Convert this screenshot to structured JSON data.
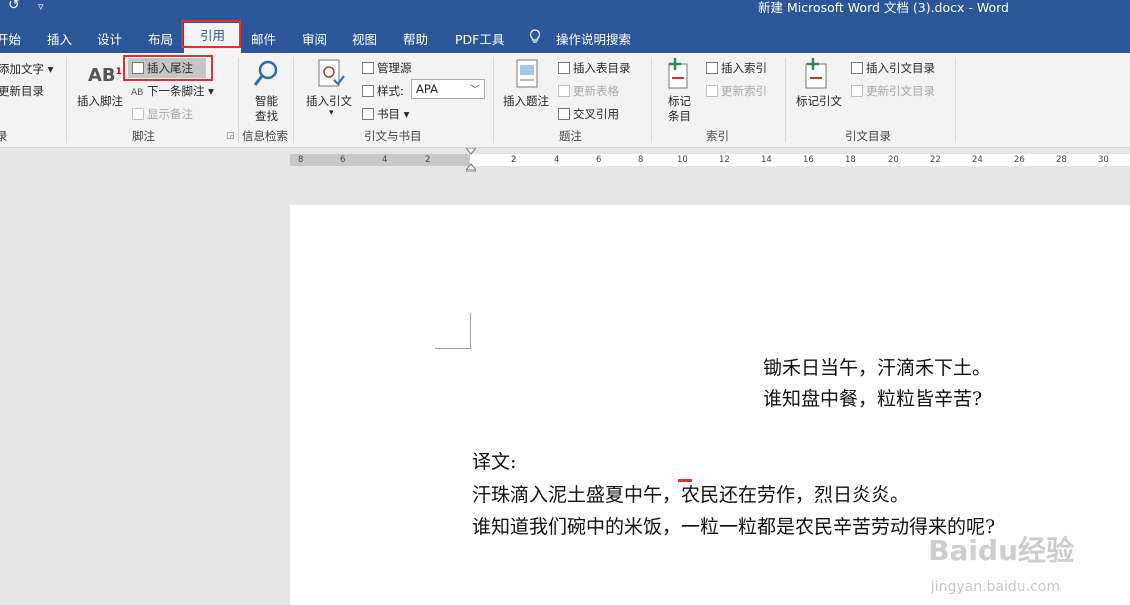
{
  "title_bar": {
    "doc_title": "新建 Microsoft Word 文档 (3).docx  -  Word",
    "undo_icon": "undo-icon",
    "customize_icon": "customize-quick-access-icon"
  },
  "tabs": [
    "开始",
    "插入",
    "设计",
    "布局",
    "引用",
    "邮件",
    "审阅",
    "视图",
    "帮助",
    "PDF工具",
    "操作说明搜索"
  ],
  "active_tab": "引用",
  "ribbon": {
    "toc_group": {
      "add_text": "添加文字",
      "update_toc": "更新目录",
      "label": "录"
    },
    "footnotes_group": {
      "insert_footnote": "插入脚注",
      "insert_endnote": "插入尾注",
      "next_footnote": "下一条脚注",
      "show_notes": "显示备注",
      "label": "脚注"
    },
    "research_group": {
      "smart_lookup_1": "智能",
      "smart_lookup_2": "查找",
      "label": "信息检索"
    },
    "citations_group": {
      "insert_citation": "插入引文",
      "manage_sources": "管理源",
      "style_label": "样式:",
      "style_value": "APA",
      "bibliography": "书目",
      "label": "引文与书目"
    },
    "captions_group": {
      "insert_caption": "插入题注",
      "insert_table_of_figures": "插入表目录",
      "update_table": "更新表格",
      "cross_reference": "交叉引用",
      "label": "题注"
    },
    "index_group": {
      "mark_entry_1": "标记",
      "mark_entry_2": "条目",
      "insert_index": "插入索引",
      "update_index": "更新索引",
      "label": "索引"
    },
    "toa_group": {
      "mark_citation": "标记引文",
      "insert_toa": "插入引文目录",
      "update_toa": "更新引文目录",
      "label": "引文目录"
    }
  },
  "ruler_numbers": [
    "8",
    "6",
    "4",
    "2",
    "2",
    "4",
    "6",
    "8",
    "10",
    "12",
    "14",
    "16",
    "18",
    "20",
    "22",
    "24",
    "26",
    "28",
    "30"
  ],
  "document": {
    "poem_line1": "锄禾日当午，汗滴禾下土。",
    "poem_line2": "谁知盘中餐，粒粒皆辛苦?",
    "translation_heading": "译文:",
    "translation_line1": "汗珠滴入泥土盛夏中午，农民还在劳作，烈日炎炎。",
    "translation_line2": "谁知道我们碗中的米饭，一粒一粒都是农民辛苦劳动得来的呢?"
  },
  "watermark": {
    "main": "Baidu经验",
    "sub": "jingyan.baidu.com"
  },
  "colors": {
    "title_bar": "#2b579a",
    "ribbon": "#f3f3f3",
    "highlight": "#e03131"
  }
}
